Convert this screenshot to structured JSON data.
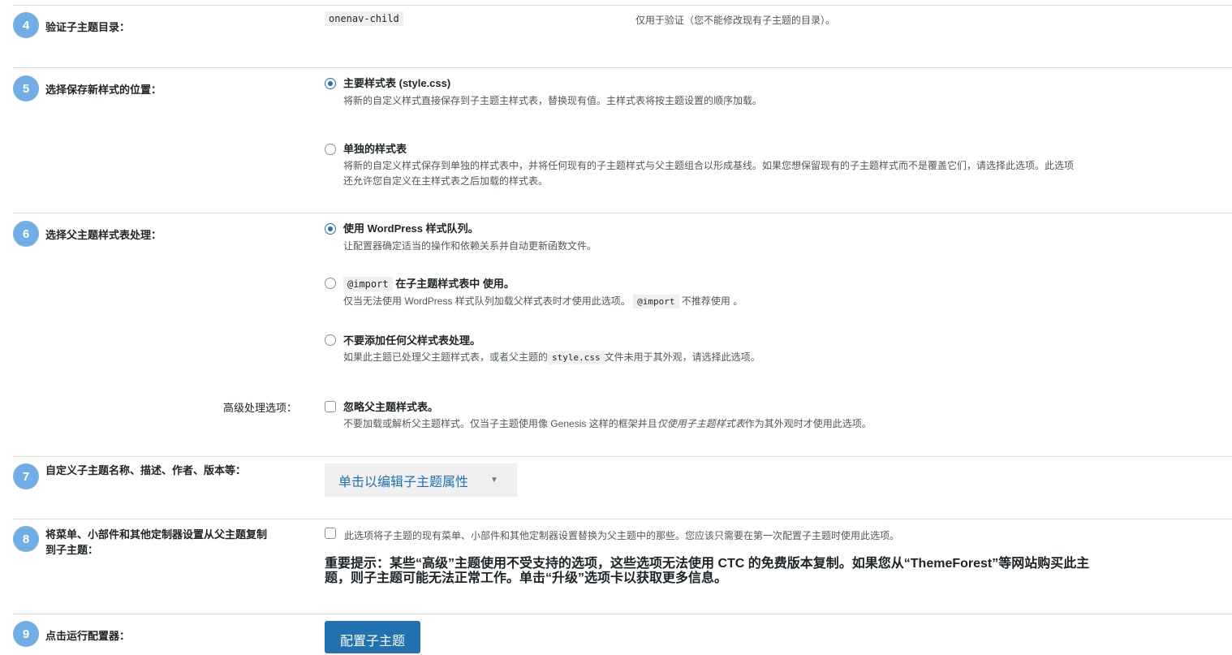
{
  "step4": {
    "number": "4",
    "label": "验证子主题目录：",
    "directory": "onenav-child",
    "note": "仅用于验证（您不能修改现有子主题的目录）。"
  },
  "step5": {
    "number": "5",
    "label": "选择保存新样式的位置：",
    "options": [
      {
        "label": "主要样式表 (style.css)",
        "checked": true,
        "description": "将新的自定义样式直接保存到子主题主样式表，替换现有值。主样式表将按主题设置的顺序加载。"
      },
      {
        "label": "单独的样式表",
        "checked": false,
        "description_line1": "将新的自定义样式保存到单独的样式表中，并将任何现有的子主题样式与父主题组合以形成基线。如果您想保留现有的子主题样式而不是覆盖它们，请选择此选项。此选项",
        "description_line2": "还允许您自定义在主样式表之后加载的样式表。"
      }
    ]
  },
  "step6": {
    "number": "6",
    "label": "选择父主题样式表处理：",
    "options": [
      {
        "label": "使用 WordPress 样式队列。",
        "checked": true,
        "description": "让配置器确定适当的操作和依赖关系并自动更新函数文件。"
      },
      {
        "label_code": "@import",
        "label_text": "在子主题样式表中 使用。",
        "checked": false,
        "desc_before": "仅当无法使用 WordPress 样式队列加载父样式表时才使用此选项。",
        "desc_code": "@import",
        "desc_after": "不推荐使用 。"
      },
      {
        "label": "不要添加任何父样式表处理。",
        "checked": false,
        "desc_before": "如果此主题已处理父主题样式表，或者父主题的",
        "desc_code": "style.css",
        "desc_after": "文件未用于其外观，请选择此选项。"
      }
    ],
    "advanced_label": "高级处理选项：",
    "advanced_option": {
      "label": "忽略父主题样式表。",
      "checked": false,
      "desc_before": "不要加载或解析父主题样式。仅当子主题使用像 Genesis 这样的框架并且",
      "desc_italic": "仅使用子主题样式表",
      "desc_after": "作为其外观时才使用此选项。"
    }
  },
  "step7": {
    "number": "7",
    "label": "自定义子主题名称、描述、作者、版本等：",
    "button_label": "单击以编辑子主题属性",
    "caret": "▼"
  },
  "step8": {
    "number": "8",
    "label_line1": "将菜单、小部件和其他定制器设置从父主题复制",
    "label_line2": "到子主题：",
    "checkbox_checked": false,
    "checkbox_text": "此选项将子主题的现有菜单、小部件和其他定制器设置替换为父主题中的那些。您应该只需要在第一次配置子主题时使用此选项。",
    "warning_line1": "重要提示：某些“高级”主题使用不受支持的选项，这些选项无法使用 CTC 的免费版本复制。如果您从“ThemeForest”等网站购买此主",
    "warning_line2": "题，则子主题可能无法正常工作。单击“升级”选项卡以获取更多信息。"
  },
  "step9": {
    "number": "9",
    "label": "点击运行配置器：",
    "button_label": "配置子主题"
  },
  "colors": {
    "accent": "#2271b1",
    "step_badge": "#72aee6",
    "divider": "#dcdcde"
  }
}
